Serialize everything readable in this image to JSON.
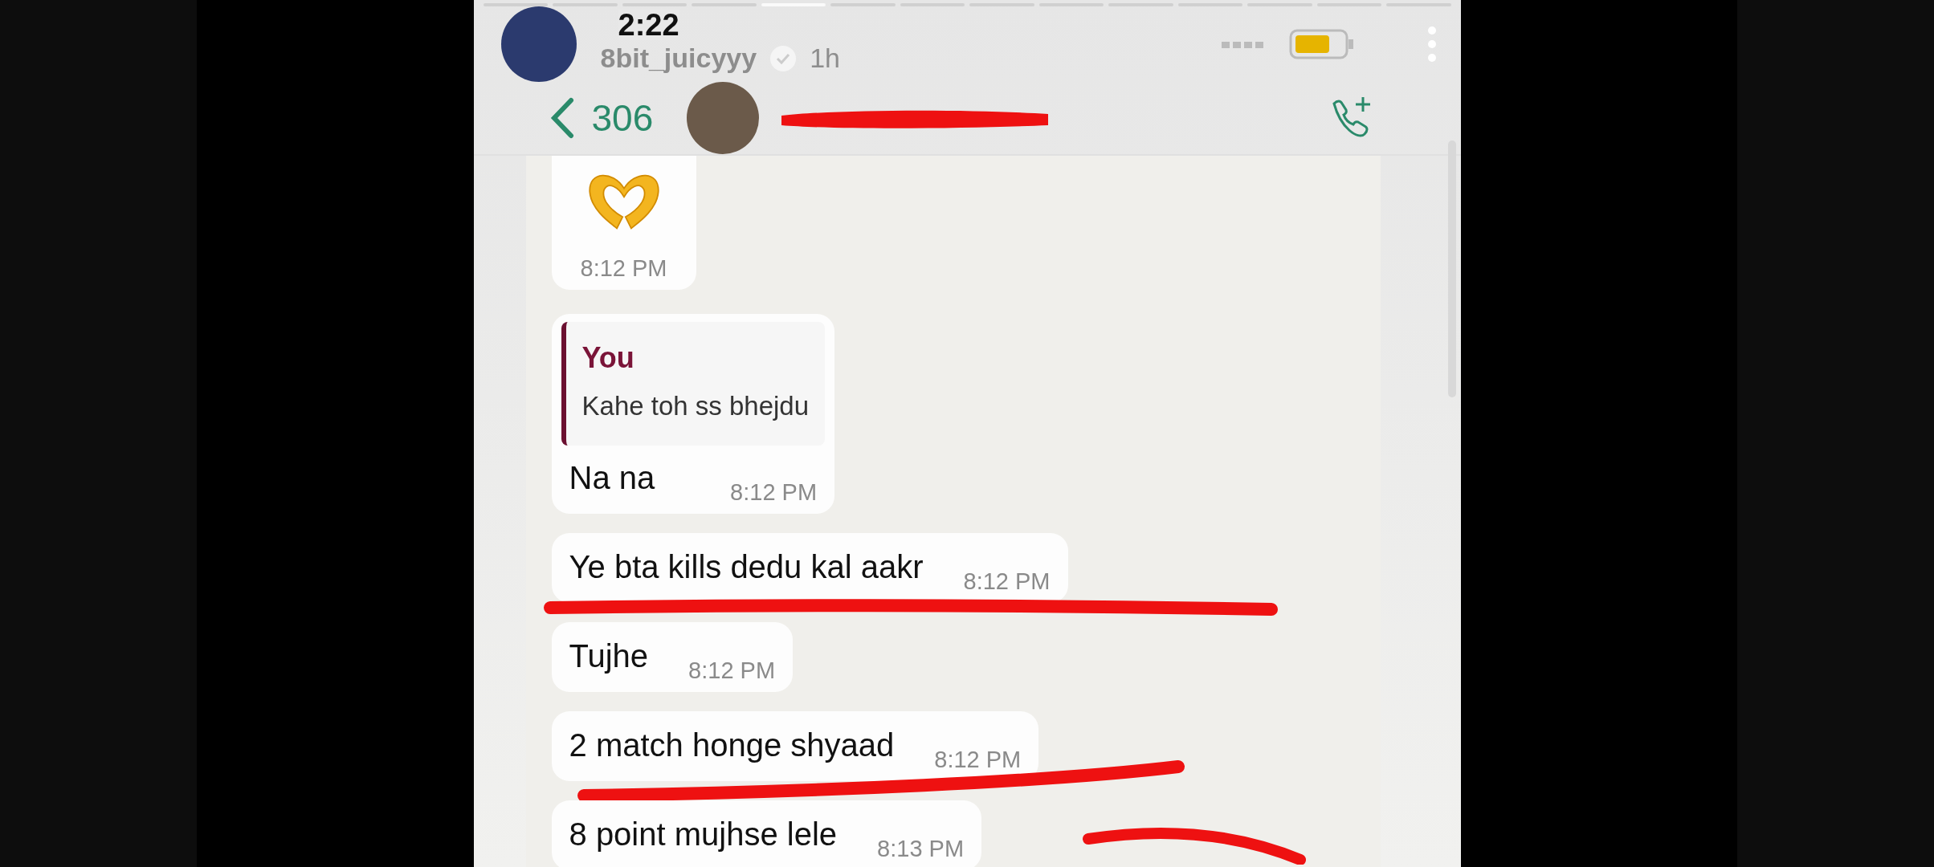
{
  "story": {
    "clock": "2:22",
    "username": "8bit_juicyyy",
    "age": "1h",
    "segments": [
      {
        "selected": false
      },
      {
        "selected": false
      },
      {
        "selected": false
      },
      {
        "selected": false
      },
      {
        "selected": true
      },
      {
        "selected": false
      },
      {
        "selected": false
      },
      {
        "selected": false
      },
      {
        "selected": false
      },
      {
        "selected": false
      },
      {
        "selected": false
      },
      {
        "selected": false
      },
      {
        "selected": false
      },
      {
        "selected": false
      }
    ]
  },
  "chat_header": {
    "back_count": "306"
  },
  "messages": [
    {
      "kind": "emoji",
      "time": "8:12 PM"
    },
    {
      "kind": "reply",
      "quote_author": "You",
      "quote_text": "Kahe toh ss bhejdu",
      "text": "Na na",
      "time": "8:12 PM"
    },
    {
      "kind": "text",
      "text": "Ye bta kills dedu kal aakr",
      "time": "8:12 PM",
      "annotation": {
        "kind": "underline"
      }
    },
    {
      "kind": "text",
      "text": "Tujhe",
      "time": "8:12 PM"
    },
    {
      "kind": "text",
      "text": "2 match honge shyaad",
      "time": "8:12 PM",
      "annotation": {
        "kind": "slant"
      }
    },
    {
      "kind": "text",
      "text": "8 point mujhse lele",
      "time": "8:13 PM",
      "annotation": {
        "kind": "curve"
      }
    }
  ]
}
